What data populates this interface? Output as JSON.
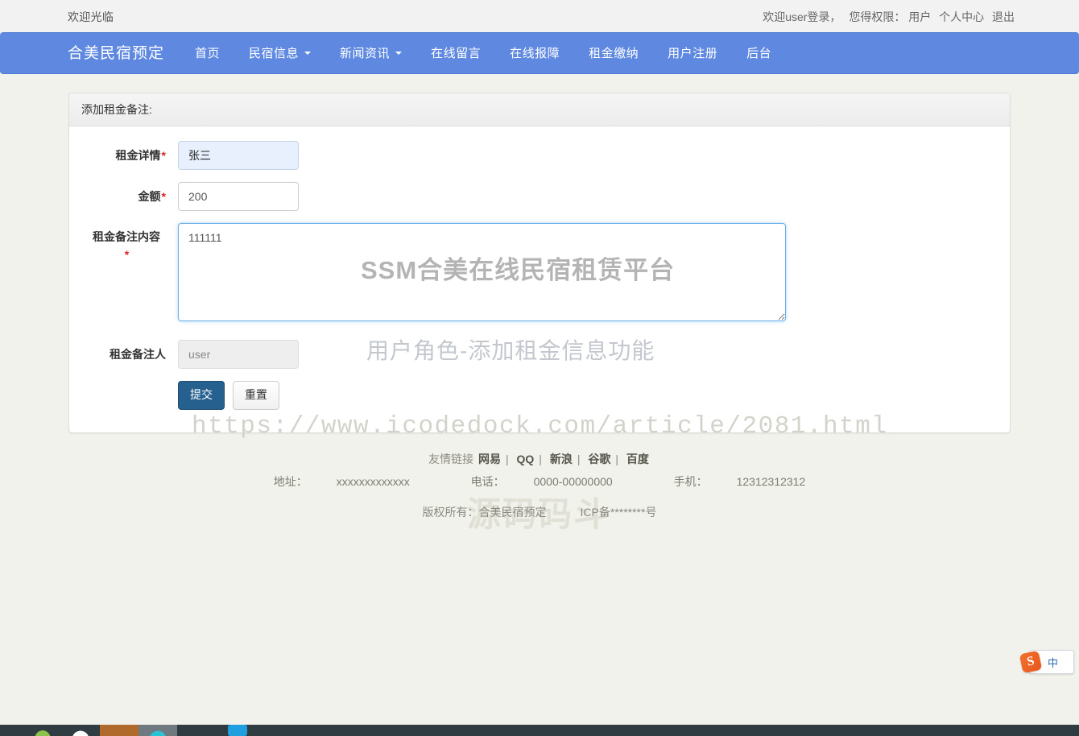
{
  "topbar": {
    "welcome": "欢迎光临",
    "login_prefix": "欢迎user登录，",
    "role_label": "您得权限：",
    "role_value": "用户",
    "profile_link": "个人中心",
    "logout_link": "退出"
  },
  "navbar": {
    "brand": "合美民宿预定",
    "items": [
      {
        "label": "首页",
        "caret": false
      },
      {
        "label": "民宿信息",
        "caret": true
      },
      {
        "label": "新闻资讯",
        "caret": true
      },
      {
        "label": "在线留言",
        "caret": false
      },
      {
        "label": "在线报障",
        "caret": false
      },
      {
        "label": "租金缴纳",
        "caret": false
      },
      {
        "label": "用户注册",
        "caret": false
      },
      {
        "label": "后台",
        "caret": false
      }
    ]
  },
  "panel": {
    "heading": "添加租金备注:",
    "fields": [
      {
        "label": "租金详情",
        "required": true,
        "value": "张三",
        "state": "autofilled"
      },
      {
        "label": "金额",
        "required": true,
        "value": "200",
        "state": "normal"
      },
      {
        "label": "租金备注内容",
        "required": true,
        "value": "111111",
        "state": "focused"
      },
      {
        "label": "租金备注人",
        "required": false,
        "value": "user",
        "state": "disabled"
      }
    ],
    "submit_label": "提交",
    "reset_label": "重置"
  },
  "watermarks": {
    "title": "SSM合美在线民宿租赁平台",
    "subtitle": "用户角色-添加租金信息功能",
    "url": "https://www.icodedock.com/article/2081.html",
    "logo": "源码码斗"
  },
  "footer": {
    "links_label": "友情链接",
    "links": [
      "网易",
      "QQ",
      "新浪",
      "谷歌",
      "百度"
    ],
    "address_label": "地址：",
    "address_value": "xxxxxxxxxxxxx",
    "phone_label": "电话：",
    "phone_value": "0000-00000000",
    "mobile_label": "手机：",
    "mobile_value": "12312312312",
    "copyright": "版权所有：合美民宿预定",
    "icp": "ICP备********号"
  },
  "ime": {
    "logo_letter": "S",
    "mode": "中"
  },
  "colors": {
    "nav_blue": "#5f89e0",
    "primary_button": "#26608f",
    "required_star": "#d9241f",
    "page_background": "#f2f2ec",
    "focus_border": "#66afe9",
    "autofill_background": "#e8f0fe"
  }
}
